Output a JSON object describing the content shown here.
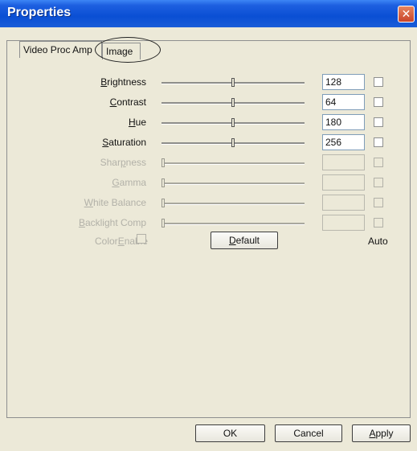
{
  "window": {
    "title": "Properties",
    "close_glyph": "✕"
  },
  "tabs": [
    {
      "label": "Video Proc Amp",
      "active": false
    },
    {
      "label": "Image",
      "active": true
    }
  ],
  "rows": [
    {
      "pre": "",
      "key": "B",
      "post": "rightness",
      "value": "128",
      "slider_fraction": 0.5,
      "enabled": true
    },
    {
      "pre": "",
      "key": "C",
      "post": "ontrast",
      "value": "64",
      "slider_fraction": 0.5,
      "enabled": true
    },
    {
      "pre": "",
      "key": "H",
      "post": "ue",
      "value": "180",
      "slider_fraction": 0.5,
      "enabled": true
    },
    {
      "pre": "",
      "key": "S",
      "post": "aturation",
      "value": "256",
      "slider_fraction": 0.5,
      "enabled": true
    },
    {
      "pre": "Shar",
      "key": "p",
      "post": "ness",
      "value": "",
      "slider_fraction": 0.0,
      "enabled": false
    },
    {
      "pre": "",
      "key": "G",
      "post": "amma",
      "value": "",
      "slider_fraction": 0.0,
      "enabled": false
    },
    {
      "pre": "",
      "key": "W",
      "post": "hite Balance",
      "value": "",
      "slider_fraction": 0.0,
      "enabled": false
    },
    {
      "pre": "",
      "key": "B",
      "post": "acklight Comp",
      "value": "",
      "slider_fraction": 0.0,
      "enabled": false
    }
  ],
  "color_enable": {
    "pre": "Color",
    "key": "E",
    "post": "nable"
  },
  "default_button": {
    "pre": "",
    "key": "D",
    "post": "efault"
  },
  "auto_label": "Auto",
  "ok_label": "OK",
  "cancel_label": "Cancel",
  "apply_button": {
    "pre": "",
    "key": "A",
    "post": "pply"
  },
  "colors": {
    "titlebar": "#0a4fd4",
    "face": "#ece9d8",
    "close": "#c9442a"
  }
}
